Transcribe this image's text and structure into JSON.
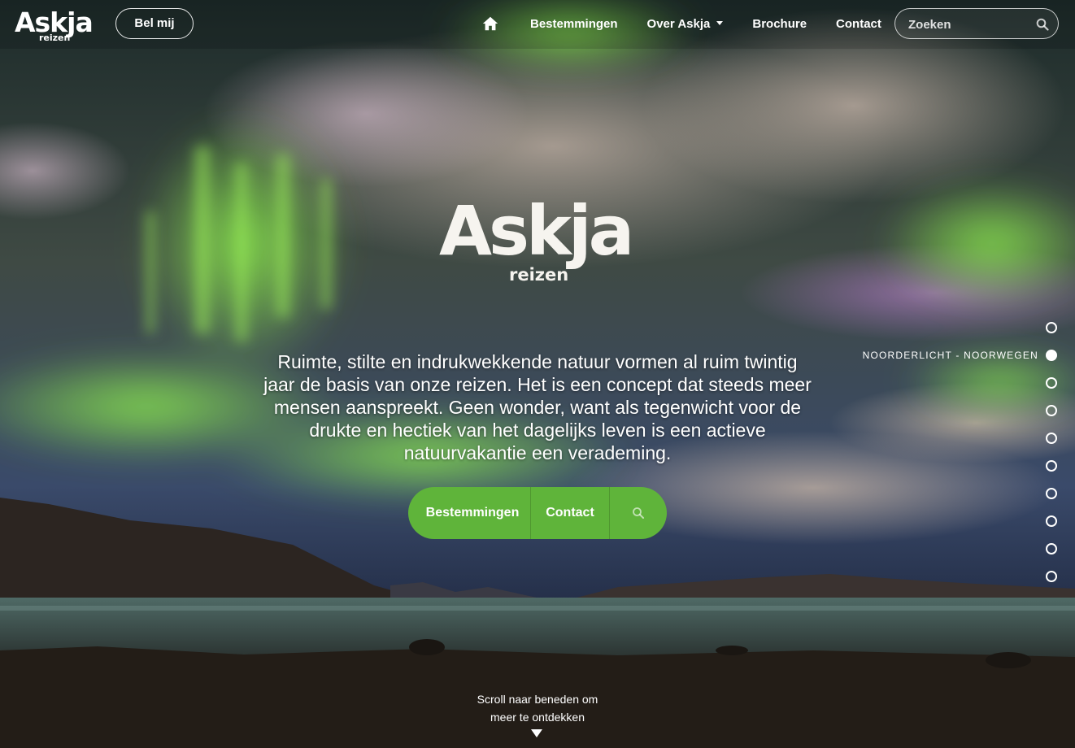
{
  "brand": {
    "name": "Askja",
    "sub": "reizen"
  },
  "header": {
    "call_label": "Bel mij",
    "nav": [
      {
        "label": "Bestemmingen"
      },
      {
        "label": "Over Askja",
        "has_dropdown": true
      },
      {
        "label": "Brochure"
      },
      {
        "label": "Contact"
      }
    ],
    "search_placeholder": "Zoeken"
  },
  "hero": {
    "intro": "Ruimte, stilte en indrukwekkende natuur vormen al ruim twintig jaar de basis van onze reizen. Het is een concept dat steeds meer mensen aanspreekt. Geen wonder, want als tegenwicht voor de drukte en hectiek van het dagelijks leven is een actieve natuurvakantie een verademing.",
    "cta_destinations": "Bestemmingen",
    "cta_contact": "Contact",
    "slide_label": "NOORDERLICHT - NOORWEGEN",
    "slide_count": 10,
    "active_slide": 2,
    "scroll_hint_line1": "Scroll naar beneden om",
    "scroll_hint_line2": "meer te ontdekken"
  },
  "colors": {
    "accent": "#5fb43a",
    "aurora": "#7fe046",
    "sky": "#1b2430"
  },
  "icons": {
    "home": "home-icon",
    "search": "search-icon",
    "caret": "chevron-down-icon",
    "scroll": "arrow-down-icon"
  }
}
